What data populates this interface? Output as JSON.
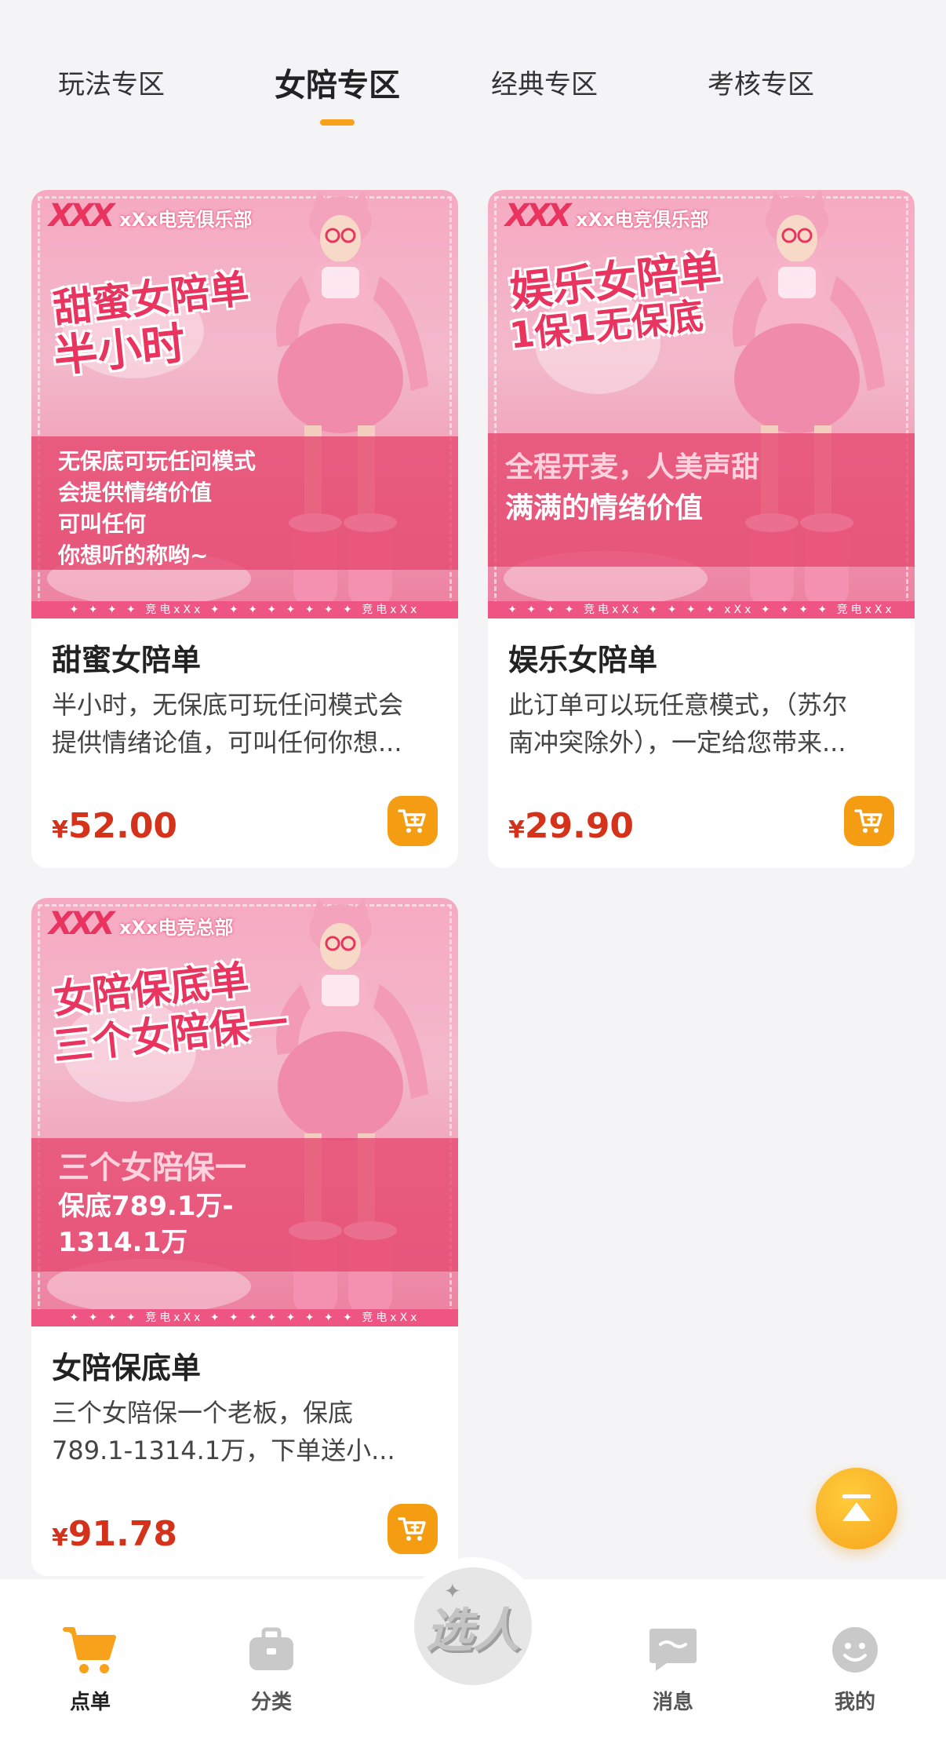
{
  "tabs": [
    {
      "label": "玩法专区",
      "active": false
    },
    {
      "label": "女陪专区",
      "active": true
    },
    {
      "label": "经典专区",
      "active": false
    },
    {
      "label": "考核专区",
      "active": false
    }
  ],
  "accent_color": "#f7a21a",
  "price_color": "#d5321b",
  "products": [
    {
      "image": {
        "logo": "XXX",
        "club": "xXx电竞俱乐部",
        "headline": [
          "甜蜜女陪单",
          "半小时"
        ],
        "band": [
          "无保底可玩任问模式",
          "会提供情绪价值",
          "可叫任何",
          "你想听的称哟~"
        ],
        "strip": "✦ ✦ ✦ ✦ 竞电xXx ✦ ✦ ✦ ✦ ✦ ✦ ✦ ✦ 竞电xXx"
      },
      "title": "甜蜜女陪单",
      "desc": "半小时，无保底可玩任问模式会\n提供情绪论值，可叫任何你想...",
      "currency": "¥",
      "price": "52.00"
    },
    {
      "image": {
        "logo": "XXX",
        "club": "xXx电竞俱乐部",
        "headline": [
          "娱乐女陪单",
          "1保1无保底"
        ],
        "band": [
          "全程开麦，人美声甜",
          "满满的情绪价值"
        ],
        "strip": "✦ ✦ ✦ ✦ 竞电xXx ✦ ✦ ✦ ✦ xXx ✦ ✦ ✦ ✦ 竞电xXx"
      },
      "title": "娱乐女陪单",
      "desc": "此订单可以玩任意模式，（苏尔\n南冲突除外），一定给您带来...",
      "currency": "¥",
      "price": "29.90"
    },
    {
      "image": {
        "logo": "XXX",
        "club": "xXx电竞总部",
        "headline": [
          "女陪保底单",
          "三个女陪保一"
        ],
        "band": [
          "三个女陪保一",
          "保底789.1万-",
          "1314.1万"
        ],
        "strip": "✦ ✦ ✦ ✦ 竞电xXx ✦ ✦ ✦ ✦ ✦ ✦ ✦ ✦ 竞电xXx"
      },
      "title": "女陪保底单",
      "desc": "三个女陪保一个老板，保底\n789.1-1314.1万，下单送小...",
      "currency": "¥",
      "price": "91.78"
    }
  ],
  "nav": {
    "items": [
      {
        "label": "点单",
        "icon": "cart-icon",
        "active": true
      },
      {
        "label": "分类",
        "icon": "bag-icon",
        "active": false
      },
      {
        "label": "消息",
        "icon": "chat-icon",
        "active": false
      },
      {
        "label": "我的",
        "icon": "smile-icon",
        "active": false
      }
    ],
    "center_label": "选人",
    "center_sparkle": "✦"
  }
}
